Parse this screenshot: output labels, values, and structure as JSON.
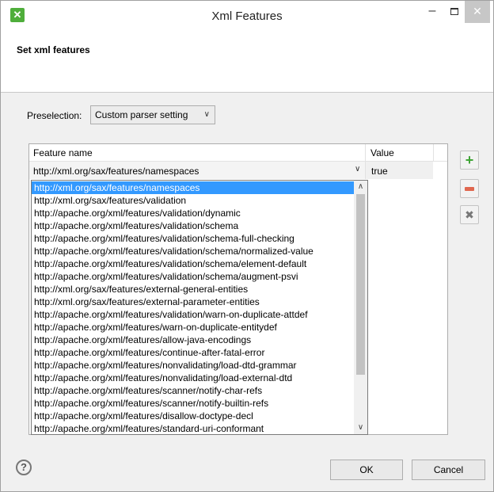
{
  "window": {
    "title": "Xml Features",
    "app_icon": "app-icon-glyph",
    "minimize_glyph": "–",
    "close_glyph": "✕"
  },
  "banner": {
    "title": "Set xml features"
  },
  "preselection": {
    "label": "Preselection:",
    "selected": "Custom parser setting",
    "arrow": "∨"
  },
  "table": {
    "columns": [
      "Feature name",
      "Value"
    ],
    "editing_row": {
      "feature": "http://xml.org/sax/features/namespaces",
      "value": "true",
      "chevron": "∨"
    }
  },
  "dropdown": {
    "selected_index": 0,
    "items": [
      "http://xml.org/sax/features/namespaces",
      "http://xml.org/sax/features/validation",
      "http://apache.org/xml/features/validation/dynamic",
      "http://apache.org/xml/features/validation/schema",
      "http://apache.org/xml/features/validation/schema-full-checking",
      "http://apache.org/xml/features/validation/schema/normalized-value",
      "http://apache.org/xml/features/validation/schema/element-default",
      "http://apache.org/xml/features/validation/schema/augment-psvi",
      "http://xml.org/sax/features/external-general-entities",
      "http://xml.org/sax/features/external-parameter-entities",
      "http://apache.org/xml/features/validation/warn-on-duplicate-attdef",
      "http://apache.org/xml/features/warn-on-duplicate-entitydef",
      "http://apache.org/xml/features/allow-java-encodings",
      "http://apache.org/xml/features/continue-after-fatal-error",
      "http://apache.org/xml/features/nonvalidating/load-dtd-grammar",
      "http://apache.org/xml/features/nonvalidating/load-external-dtd",
      "http://apache.org/xml/features/scanner/notify-char-refs",
      "http://apache.org/xml/features/scanner/notify-builtin-refs",
      "http://apache.org/xml/features/disallow-doctype-decl",
      "http://apache.org/xml/features/standard-uri-conformant"
    ],
    "scroll_up": "∧",
    "scroll_down": "∨"
  },
  "side_buttons": {
    "add_glyph": "+",
    "clear_glyph": "✖"
  },
  "footer": {
    "help_glyph": "?",
    "ok_label": "OK",
    "cancel_label": "Cancel"
  },
  "colors": {
    "selection": "#3399ff",
    "add_icon": "#3fa435",
    "remove_icon": "#e0674f"
  }
}
